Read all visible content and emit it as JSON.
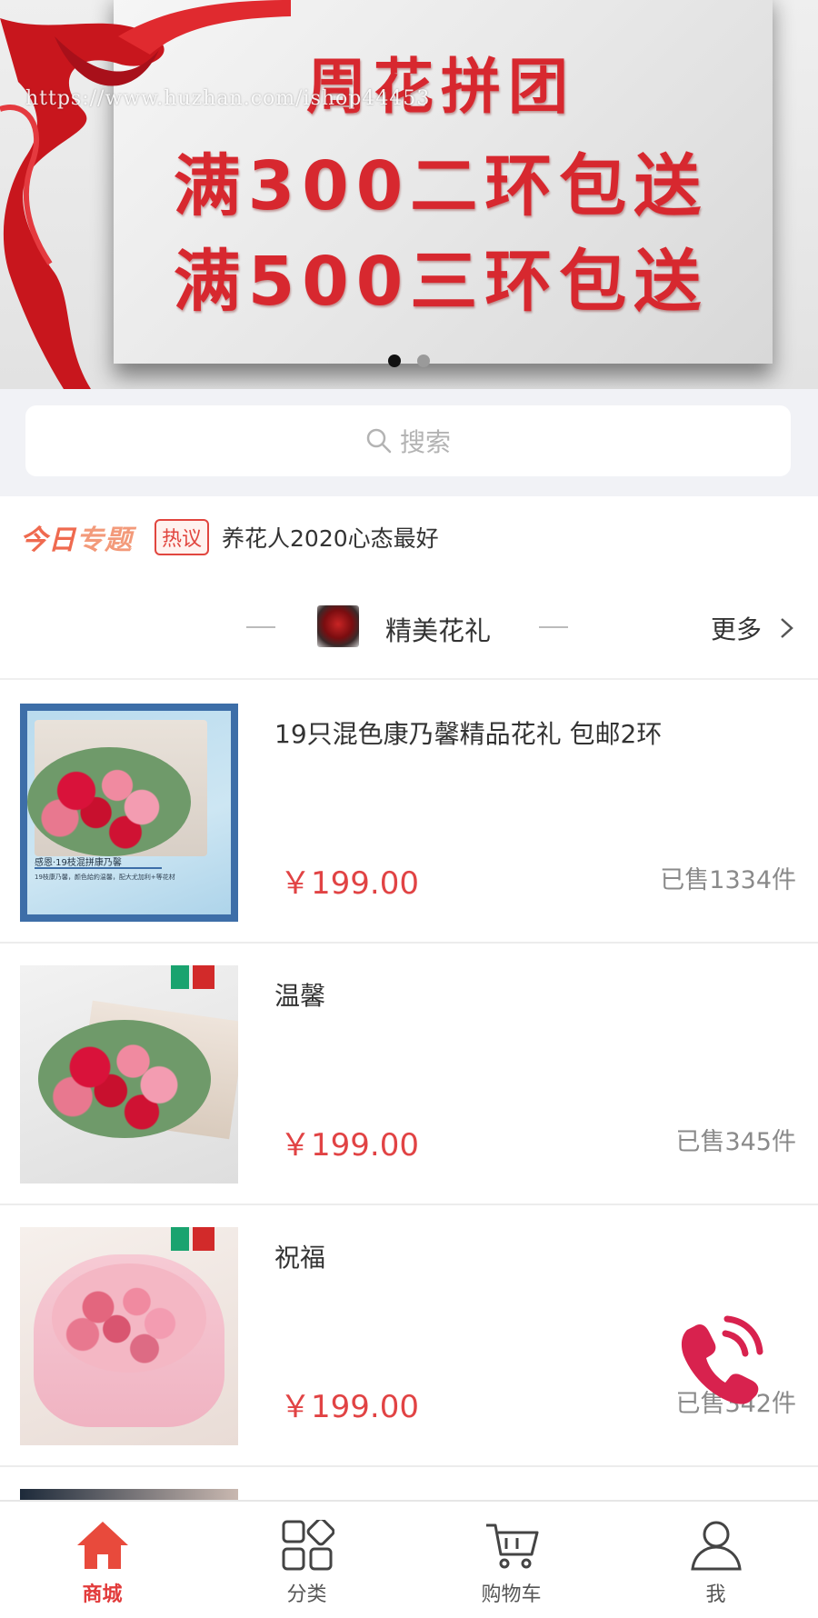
{
  "banner": {
    "line1": "周花拼团",
    "line2": "满300二环包送",
    "line3": "满500三环包送",
    "watermark": "https://www.huzhan.com/ishop44453",
    "dots": [
      true,
      false
    ]
  },
  "search": {
    "placeholder": "搜索"
  },
  "topic": {
    "logo_a": "今日",
    "logo_b": "专题",
    "tag": "热议",
    "text": "养花人2020心态最好"
  },
  "section": {
    "title": "精美花礼",
    "more": "更多"
  },
  "products": [
    {
      "name": "19只混色康乃馨精品花礼 包邮2环",
      "price": "￥199.00",
      "sold": "已售1334件",
      "image_caption": "感恩·19枝混拼康乃馨",
      "image_caption_small": "19枝康乃馨，颜色給約温馨，配大尤加利+等花材"
    },
    {
      "name": "温馨",
      "price": "￥199.00",
      "sold": "已售345件"
    },
    {
      "name": "祝福",
      "price": "￥199.00",
      "sold": "已售342件"
    }
  ],
  "tabs": [
    {
      "label": "商城",
      "icon": "home-icon",
      "active": true
    },
    {
      "label": "分类",
      "icon": "category-icon",
      "active": false
    },
    {
      "label": "购物车",
      "icon": "cart-icon",
      "active": false
    },
    {
      "label": "我",
      "icon": "user-icon",
      "active": false
    }
  ],
  "colors": {
    "accent": "#e23b3b",
    "price": "#e14344",
    "banner_text": "#d7282f"
  }
}
